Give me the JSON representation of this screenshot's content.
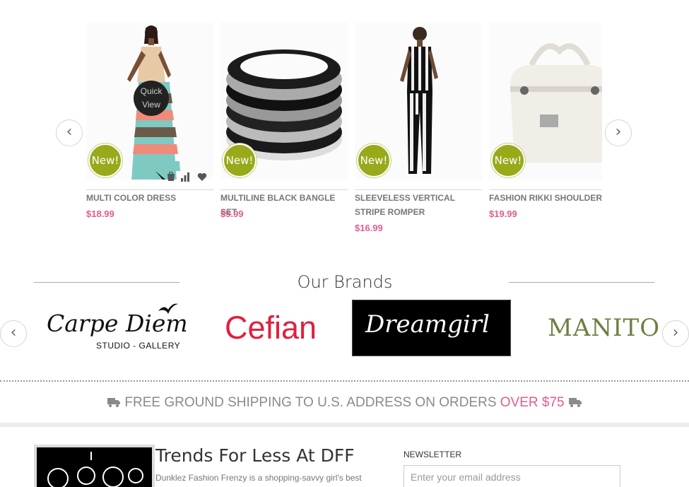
{
  "products": [
    {
      "name": "MULTI COLOR DRESS",
      "price": "$18.99",
      "badge": "New!"
    },
    {
      "name": "MULTILINE BLACK BANGLE SET",
      "price": "$5.99",
      "badge": "New!"
    },
    {
      "name": "SLEEVELESS VERTICAL STRIPE ROMPER",
      "price": "$16.99",
      "badge": "New!"
    },
    {
      "name": "FASHION RIKKI SHOULDER BAG",
      "price": "$19.99",
      "badge": "New!"
    }
  ],
  "quick_view": "Quick View",
  "product_actions": [
    "cart-icon",
    "compare-icon",
    "wishlist-icon"
  ],
  "carousel_nav": {
    "prev": "‹",
    "next": "›"
  },
  "brands": {
    "heading": "Our Brands",
    "items": [
      {
        "name": "Carpe Diem",
        "sub": "STUDIO - GALLERY"
      },
      {
        "name": "Cefian"
      },
      {
        "name": "Dreamgirl"
      },
      {
        "name": "MANITO"
      }
    ]
  },
  "shipping": {
    "text": "FREE GROUND SHIPPING TO U.S. ADDRESS ON ORDERS ",
    "highlight": "OVER $75",
    "icon": "truck-icon"
  },
  "footer": {
    "title": "Trends For Less At DFF",
    "text": "Dunklez Fashion Frenzy is a shopping-savvy girl's best",
    "newsletter_label": "NEWSLETTER",
    "newsletter_placeholder": "Enter your email address"
  },
  "colors": {
    "accent_pink": "#e05b8f",
    "badge_green": "#98aa1a"
  }
}
